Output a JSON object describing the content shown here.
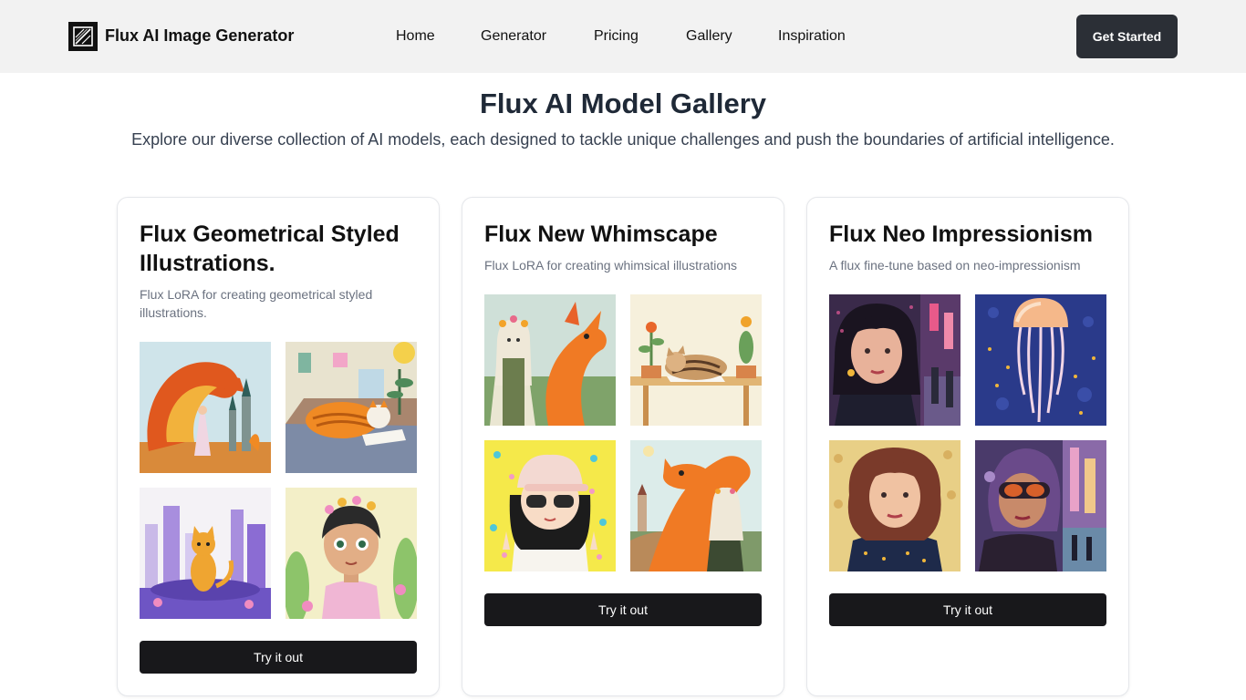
{
  "header": {
    "brand": "Flux AI Image Generator",
    "nav": [
      "Home",
      "Generator",
      "Pricing",
      "Gallery",
      "Inspiration"
    ],
    "cta": "Get Started"
  },
  "main": {
    "title": "Flux AI Model Gallery",
    "subtitle": "Explore our diverse collection of AI models, each designed to tackle unique challenges and push the boundaries of artificial intelligence."
  },
  "cards": [
    {
      "title": "Flux Geometrical Styled Illustrations.",
      "description": "Flux LoRA for creating geometrical styled illustrations.",
      "button": "Try it out",
      "images": [
        "dragon-and-princess-castle",
        "orange-tabby-cat-sleeping-on-book",
        "cat-in-purple-city",
        "girl-with-flower-crown"
      ]
    },
    {
      "title": "Flux New Whimscape",
      "description": "Flux LoRA for creating whimsical illustrations",
      "button": "Try it out",
      "images": [
        "girl-with-orange-dragon",
        "cat-sleeping-on-table",
        "girl-in-sunglasses-and-cap",
        "orange-dragon-and-girl"
      ]
    },
    {
      "title": "Flux Neo Impressionism",
      "description": "A flux fine-tune based on neo-impressionism",
      "button": "Try it out",
      "images": [
        "woman-portrait-city-night",
        "jellyfish",
        "woman-portrait-curly-hair",
        "woman-with-goggles-city"
      ]
    }
  ],
  "colors": {
    "header_bg": "#f2f2f2",
    "cta_bg": "#2b2f36",
    "button_bg": "#18181b",
    "title": "#1f2937"
  }
}
